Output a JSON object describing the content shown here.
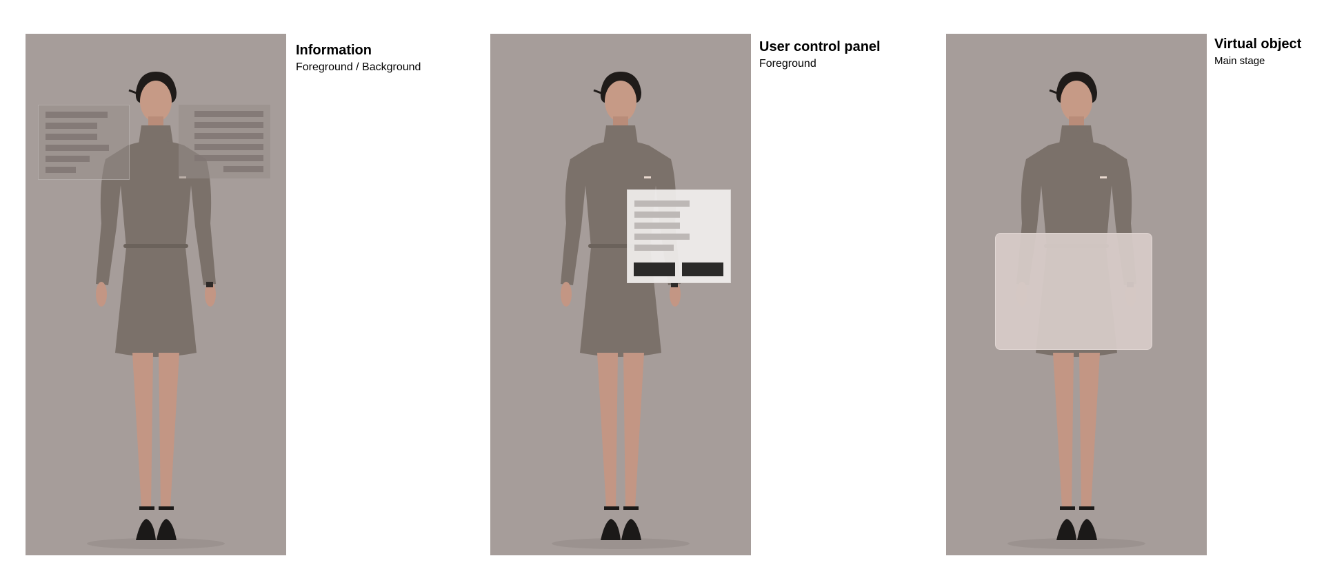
{
  "panels": [
    {
      "title": "Information",
      "subtitle": "Foreground / Background"
    },
    {
      "title": "User control panel",
      "subtitle": "Foreground"
    },
    {
      "title": "Virtual object",
      "subtitle": "Main stage"
    }
  ],
  "colors": {
    "panel_background": "#a69d9a",
    "dress": "#7b716a",
    "control_button": "#2b2a29",
    "virtual_object": "#d6cac7"
  },
  "icons": [
    "woman-figure"
  ]
}
